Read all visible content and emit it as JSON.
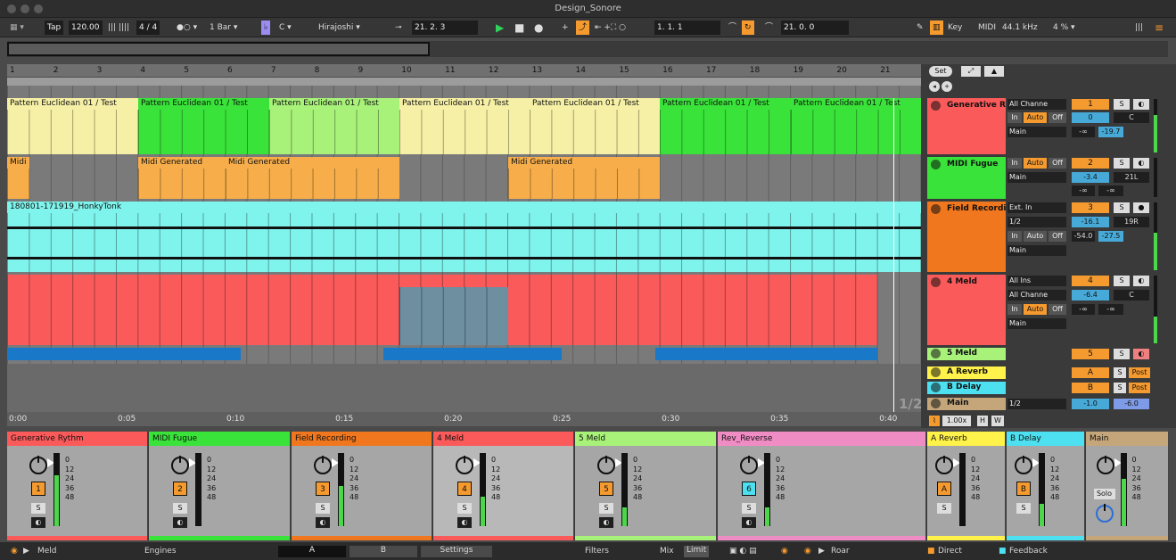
{
  "app": {
    "title": "Design_Sonore"
  },
  "control_bar": {
    "tap": "Tap",
    "tempo": "120.00",
    "signature": "4 / 4",
    "quantize": "1 Bar",
    "key": "C",
    "scale": "Hirajoshi",
    "position": "21. 2. 3",
    "loop_start": "1. 1. 1",
    "loop_length": "21. 0. 0",
    "key_btn": "Key",
    "midi_btn": "MIDI",
    "sample_rate": "44.1 kHz",
    "cpu": "4 %",
    "dropdown_glyph": "▾"
  },
  "arrangement": {
    "bar_numbers": [
      "1",
      "2",
      "3",
      "4",
      "5",
      "6",
      "7",
      "8",
      "9",
      "10",
      "11",
      "12",
      "13",
      "14",
      "15",
      "16",
      "17",
      "18",
      "19",
      "20",
      "21"
    ],
    "time_ticks": [
      "0:00",
      "0:05",
      "0:10",
      "0:15",
      "0:20",
      "0:25",
      "0:30",
      "0:35",
      "0:40"
    ],
    "scroll_label": "1/2",
    "track1_clips": [
      "Pattern Euclidean 01 / Test",
      "Pattern Euclidean 01 / Test",
      "Pattern Euclidean 01 / Test",
      "Pattern Euclidean 01 / Test",
      "Pattern Euclidean 01 / Test",
      "Pattern Euclidean 01 / Test",
      "Pattern Euclidean 01 / Test"
    ],
    "track2_clips": [
      "Midi",
      "Midi Generated",
      "Midi Generated",
      "Midi Generated"
    ],
    "audio_clip": "180801-171919_HonkyTonk"
  },
  "panel": {
    "set_label": "Set",
    "zoom_label": "1.00x",
    "h_btn": "H",
    "w_btn": "W"
  },
  "tracks": [
    {
      "name": "Generative R",
      "input": "All Channe",
      "in": "In",
      "auto": "Auto",
      "off": "Off",
      "out": "Main",
      "num": "1",
      "s": "S",
      "vol": "0",
      "pan": "C",
      "v1": "-∞",
      "v2": "-19.7",
      "color": "#fb5a5a"
    },
    {
      "name": "MIDI Fugue",
      "in": "In",
      "auto": "Auto",
      "off": "Off",
      "out": "Main",
      "num": "2",
      "s": "S",
      "vol": "-3.4",
      "pan": "21L",
      "v1": "-∞",
      "v2": "-∞",
      "color": "#39e339"
    },
    {
      "name": "Field Recordi",
      "input": "Ext. In",
      "input2": "1/2",
      "in": "In",
      "auto": "Auto",
      "off": "Off",
      "out": "Main",
      "num": "3",
      "s": "S",
      "vol": "-16.1",
      "pan": "19R",
      "v1": "-54.0",
      "v2": "-27.5",
      "color": "#f0771e"
    },
    {
      "name": "4 Meld",
      "input": "All Ins",
      "input2": "All Channe",
      "in": "In",
      "auto": "Auto",
      "off": "Off",
      "out": "Main",
      "num": "4",
      "s": "S",
      "vol": "-6.4",
      "pan": "C",
      "v1": "-∞",
      "v2": "-∞",
      "color": "#fb5a5a"
    },
    {
      "name": "5 Meld",
      "num": "5",
      "s": "S",
      "color": "#a8f27a"
    },
    {
      "name": "A Reverb",
      "num": "A",
      "s": "S",
      "post": "Post",
      "color": "#fff24a"
    },
    {
      "name": "B Delay",
      "num": "B",
      "s": "S",
      "post": "Post",
      "color": "#4ce0f0"
    },
    {
      "name": "Main",
      "out": "1/2",
      "vol": "-1.0",
      "pan": "-6.0",
      "color": "#c4a67a"
    }
  ],
  "mixer": {
    "scale": [
      "0",
      "12",
      "24",
      "36",
      "48"
    ],
    "solo": "Solo",
    "strips": [
      {
        "name": "Generative Rythm",
        "num": "1",
        "s": "S",
        "color": "#fb5a5a",
        "level": 0.7
      },
      {
        "name": "MIDI Fugue",
        "num": "2",
        "s": "S",
        "color": "#39e339",
        "level": 0.0
      },
      {
        "name": "Field Recording",
        "num": "3",
        "s": "S",
        "color": "#f0771e",
        "level": 0.55
      },
      {
        "name": "4 Meld",
        "num": "4",
        "s": "S",
        "color": "#fb5a5a",
        "level": 0.4
      },
      {
        "name": "5 Meld",
        "num": "5",
        "s": "S",
        "color": "#a8f27a",
        "level": 0.25
      },
      {
        "name": "Rev_Reverse",
        "num": "6",
        "s": "S",
        "color": "#f08cc4",
        "level": 0.25
      },
      {
        "name": "A Reverb",
        "num": "A",
        "s": "S",
        "color": "#fff24a",
        "level": 0.0
      },
      {
        "name": "B Delay",
        "num": "B",
        "s": "S",
        "color": "#4ce0f0",
        "level": 0.3
      },
      {
        "name": "Main",
        "num": "",
        "s": "",
        "color": "#c4a67a",
        "level": 0.65
      }
    ]
  },
  "bottom": {
    "device": "Meld",
    "engines": "Engines",
    "tab_a": "A",
    "tab_b": "B",
    "settings": "Settings",
    "filters": "Filters",
    "mix": "Mix",
    "limit": "Limit",
    "roar": "Roar",
    "direct": "Direct",
    "feedback": "Feedback"
  }
}
